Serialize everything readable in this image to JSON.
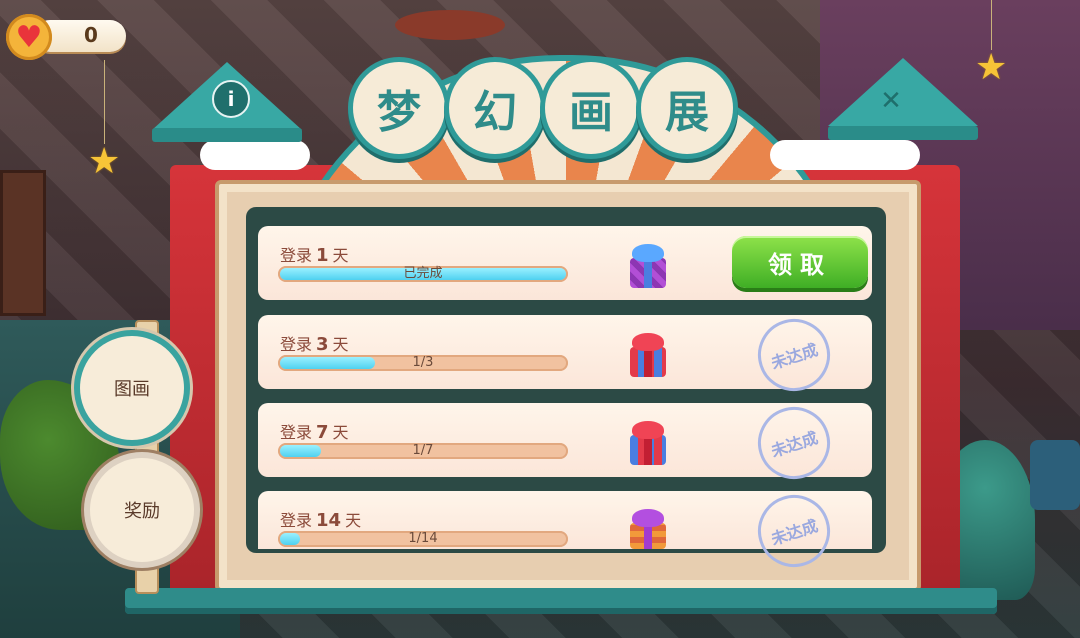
{
  "lives": {
    "icon": "heart-icon",
    "count": "0"
  },
  "title": {
    "chars": [
      "梦",
      "幻",
      "画",
      "展"
    ]
  },
  "buttons": {
    "info_symbol": "i",
    "close_symbol": "✕"
  },
  "side_menu": [
    {
      "label": "图画"
    },
    {
      "label": "奖励"
    }
  ],
  "rewards": [
    {
      "label_prefix": "登录",
      "day": "1",
      "label_suffix": "天",
      "progress_text": "已完成",
      "progress_fraction": 1.0,
      "gift_color": "purple-blue",
      "status": "claimable",
      "claim_label": "领取"
    },
    {
      "label_prefix": "登录",
      "day": "3",
      "label_suffix": "天",
      "progress_text": "1/3",
      "progress_fraction": 0.333,
      "gift_color": "red-blue",
      "status": "not_reached",
      "status_label": "未达成"
    },
    {
      "label_prefix": "登录",
      "day": "7",
      "label_suffix": "天",
      "progress_text": "1/7",
      "progress_fraction": 0.143,
      "gift_color": "red-blue",
      "status": "not_reached",
      "status_label": "未达成"
    },
    {
      "label_prefix": "登录",
      "day": "14",
      "label_suffix": "天",
      "progress_text": "1/14",
      "progress_fraction": 0.071,
      "gift_color": "purple-orange",
      "status": "not_reached",
      "status_label": "未达成"
    }
  ],
  "colors": {
    "accent_teal": "#2f9a98",
    "banner_red": "#d6343a",
    "claim_green": "#3fae25",
    "progress_cyan": "#4fd1f0"
  }
}
